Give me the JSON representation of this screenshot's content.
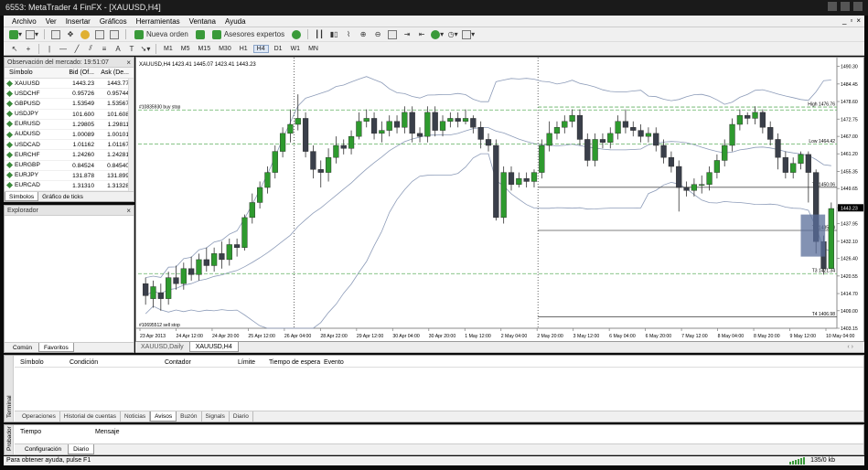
{
  "window": {
    "title": "6553: MetaTrader 4 FinFX - [XAUUSD,H4]"
  },
  "menu": [
    "Archivo",
    "Ver",
    "Insertar",
    "Gráficos",
    "Herramientas",
    "Ventana",
    "Ayuda"
  ],
  "toolbar": {
    "new_order": "Nueva orden",
    "expert_advisors": "Asesores expertos",
    "timeframes": [
      "M1",
      "M5",
      "M15",
      "M30",
      "H1",
      "H4",
      "D1",
      "W1",
      "MN"
    ],
    "active_timeframe": "H4"
  },
  "market_watch": {
    "title": "Observación del mercado: 19:51:07",
    "columns": [
      "Símbolo",
      "Bid (Of...",
      "Ask (De..."
    ],
    "rows": [
      {
        "symbol": "XAUUSD",
        "bid": "1443.23",
        "ask": "1443.77"
      },
      {
        "symbol": "USDCHF",
        "bid": "0.95726",
        "ask": "0.95744"
      },
      {
        "symbol": "GBPUSD",
        "bid": "1.53549",
        "ask": "1.53567"
      },
      {
        "symbol": "USDJPY",
        "bid": "101.600",
        "ask": "101.608"
      },
      {
        "symbol": "EURUSD",
        "bid": "1.29805",
        "ask": "1.29811"
      },
      {
        "symbol": "AUDUSD",
        "bid": "1.00089",
        "ask": "1.00101"
      },
      {
        "symbol": "USDCAD",
        "bid": "1.01162",
        "ask": "1.01167"
      },
      {
        "symbol": "EURCHF",
        "bid": "1.24260",
        "ask": "1.24281"
      },
      {
        "symbol": "EURGBP",
        "bid": "0.84524",
        "ask": "0.84540"
      },
      {
        "symbol": "EURJPY",
        "bid": "131.878",
        "ask": "131.899"
      },
      {
        "symbol": "EURCAD",
        "bid": "1.31310",
        "ask": "1.31328"
      }
    ],
    "tabs": [
      "Símbolos",
      "Gráfico de ticks"
    ],
    "active_tab": "Símbolos"
  },
  "explorer": {
    "title": "Explorador",
    "tabs": [
      "Común",
      "Favoritos"
    ],
    "active_tab": "Favoritos"
  },
  "chart": {
    "header": "XAUUSD,H4  1423.41 1445.07 1423.41 1443.23",
    "current_price": "1443.23",
    "tabs": [
      "XAUUSD,Daily",
      "XAUUSD,H4"
    ],
    "active_tab": "XAUUSD,H4"
  },
  "chart_data": {
    "type": "candlestick",
    "symbol": "XAUUSD",
    "timeframe": "H4",
    "ylim": [
      1403.15,
      1492.0
    ],
    "y_ticks": [
      1490.3,
      1484.45,
      1478.6,
      1472.75,
      1467.0,
      1461.2,
      1455.35,
      1449.65,
      1443.23,
      1437.95,
      1432.1,
      1426.4,
      1420.55,
      1414.7,
      1409.0,
      1403.15
    ],
    "x_labels": [
      "23 Apr 2013",
      "24 Apr 12:00",
      "24 Apr 20:00",
      "25 Apr 12:00",
      "26 Apr 04:00",
      "28 Apr 22:00",
      "29 Apr 12:00",
      "30 Apr 04:00",
      "30 Apr 20:00",
      "1 May 12:00",
      "2 May 04:00",
      "2 May 20:00",
      "3 May 12:00",
      "6 May 04:00",
      "6 May 20:00",
      "7 May 12:00",
      "8 May 04:00",
      "8 May 20:00",
      "9 May 12:00",
      "10 May 04:00"
    ],
    "candles": [
      [
        1418,
        1414,
        1420,
        1411
      ],
      [
        1413,
        1417,
        1419,
        1410
      ],
      [
        1415,
        1413,
        1418,
        1409
      ],
      [
        1413,
        1420,
        1422,
        1411
      ],
      [
        1420,
        1418,
        1424,
        1416
      ],
      [
        1418,
        1423,
        1425,
        1416
      ],
      [
        1423,
        1421,
        1427,
        1419
      ],
      [
        1421,
        1426,
        1428,
        1419
      ],
      [
        1426,
        1424,
        1430,
        1422
      ],
      [
        1424,
        1428,
        1430,
        1422
      ],
      [
        1428,
        1426,
        1432,
        1423
      ],
      [
        1426,
        1431,
        1433,
        1424
      ],
      [
        1431,
        1430,
        1433,
        1427
      ],
      [
        1430,
        1440,
        1441,
        1429
      ],
      [
        1440,
        1445,
        1448,
        1438
      ],
      [
        1445,
        1450,
        1452,
        1443
      ],
      [
        1450,
        1455,
        1457,
        1448
      ],
      [
        1455,
        1462,
        1464,
        1453
      ],
      [
        1462,
        1468,
        1470,
        1460
      ],
      [
        1468,
        1471,
        1476,
        1465
      ],
      [
        1471,
        1473,
        1481,
        1469
      ],
      [
        1473,
        1462,
        1475,
        1460
      ],
      [
        1462,
        1456,
        1464,
        1453
      ],
      [
        1456,
        1455,
        1459,
        1450
      ],
      [
        1455,
        1460,
        1463,
        1452
      ],
      [
        1460,
        1464,
        1467,
        1458
      ],
      [
        1464,
        1463,
        1466,
        1461
      ],
      [
        1463,
        1467,
        1469,
        1461
      ],
      [
        1467,
        1472,
        1475,
        1466
      ],
      [
        1472,
        1473,
        1476,
        1470
      ],
      [
        1473,
        1468,
        1475,
        1466
      ],
      [
        1468,
        1469,
        1472,
        1465
      ],
      [
        1469,
        1472,
        1474,
        1467
      ],
      [
        1472,
        1470,
        1474,
        1468
      ],
      [
        1470,
        1475,
        1477,
        1468
      ],
      [
        1475,
        1468,
        1477,
        1465
      ],
      [
        1468,
        1467,
        1470,
        1465
      ],
      [
        1467,
        1475,
        1477,
        1465
      ],
      [
        1475,
        1469,
        1477,
        1467
      ],
      [
        1469,
        1472,
        1474,
        1467
      ],
      [
        1472,
        1473,
        1475,
        1470
      ],
      [
        1473,
        1472,
        1475,
        1470
      ],
      [
        1472,
        1473,
        1476,
        1471
      ],
      [
        1473,
        1470,
        1474,
        1468
      ],
      [
        1470,
        1466,
        1472,
        1463
      ],
      [
        1466,
        1464,
        1468,
        1462
      ],
      [
        1464,
        1440,
        1466,
        1439
      ],
      [
        1440,
        1455,
        1457,
        1438
      ],
      [
        1455,
        1451,
        1457,
        1449
      ],
      [
        1451,
        1453,
        1455,
        1450
      ],
      [
        1453,
        1452,
        1455,
        1450
      ],
      [
        1452,
        1455,
        1456,
        1450
      ],
      [
        1455,
        1464,
        1466,
        1453
      ],
      [
        1464,
        1468,
        1472,
        1462
      ],
      [
        1468,
        1470,
        1472,
        1466
      ],
      [
        1470,
        1472,
        1474,
        1468
      ],
      [
        1472,
        1474,
        1476,
        1470
      ],
      [
        1474,
        1466,
        1476,
        1464
      ],
      [
        1466,
        1459,
        1468,
        1457
      ],
      [
        1459,
        1466,
        1468,
        1457
      ],
      [
        1466,
        1465,
        1468,
        1463
      ],
      [
        1465,
        1468,
        1470,
        1463
      ],
      [
        1468,
        1472,
        1474,
        1466
      ],
      [
        1472,
        1470,
        1476,
        1468
      ],
      [
        1470,
        1469,
        1472,
        1467
      ],
      [
        1469,
        1467,
        1471,
        1465
      ],
      [
        1467,
        1468,
        1470,
        1465
      ],
      [
        1468,
        1464,
        1470,
        1462
      ],
      [
        1464,
        1460,
        1466,
        1458
      ],
      [
        1460,
        1457,
        1462,
        1455
      ],
      [
        1457,
        1450,
        1459,
        1442
      ],
      [
        1450,
        1449,
        1452,
        1447
      ],
      [
        1449,
        1451,
        1453,
        1447
      ],
      [
        1451,
        1451,
        1454,
        1448
      ],
      [
        1451,
        1455,
        1457,
        1449
      ],
      [
        1455,
        1459,
        1461,
        1453
      ],
      [
        1459,
        1464,
        1466,
        1457
      ],
      [
        1464,
        1471,
        1473,
        1462
      ],
      [
        1471,
        1474,
        1476,
        1469
      ],
      [
        1474,
        1473,
        1475,
        1471
      ],
      [
        1473,
        1475,
        1477,
        1471
      ],
      [
        1475,
        1470,
        1476,
        1468
      ],
      [
        1470,
        1466,
        1472,
        1464
      ],
      [
        1466,
        1460,
        1468,
        1456
      ],
      [
        1460,
        1455,
        1462,
        1453
      ],
      [
        1455,
        1458,
        1460,
        1453
      ],
      [
        1458,
        1461,
        1462,
        1456
      ],
      [
        1461,
        1455,
        1462,
        1445
      ],
      [
        1455,
        1432,
        1456,
        1428
      ],
      [
        1432,
        1423,
        1434,
        1421
      ],
      [
        1423,
        1443,
        1445,
        1423
      ]
    ],
    "levels": [
      {
        "label": "#10835930 buy stop",
        "value": 1475.8,
        "style": "dashed",
        "color": "#60b060"
      },
      {
        "label": "High 1476.76",
        "value": 1476.76,
        "style": "dashed",
        "color": "#60b060"
      },
      {
        "label": "Low 1464.42",
        "value": 1464.42,
        "style": "dashed",
        "color": "#60b060"
      },
      {
        "label": "T1 1450.06",
        "value": 1450.06,
        "style": "solid",
        "color": "#555555"
      },
      {
        "label": "T2 1435.70",
        "value": 1435.7,
        "style": "solid",
        "color": "#555555"
      },
      {
        "label": "T3 1421.34",
        "value": 1421.34,
        "style": "dashed",
        "color": "#60b060"
      },
      {
        "label": "T4 1406.98",
        "value": 1406.98,
        "style": "solid",
        "color": "#555555"
      },
      {
        "label": "#10695512 sell stop",
        "value": 1403.2,
        "style": "none",
        "color": "#000000"
      }
    ],
    "colors": {
      "bull": "#2e9a2e",
      "bear": "#3a3f4a",
      "band": "#8c9bb8",
      "grid_dashed": "#60b060"
    }
  },
  "terminal": {
    "side_label": "Terminal",
    "columns": [
      "Símbolo",
      "Condición",
      "Contador",
      "Límite",
      "Tiempo de espera",
      "Evento"
    ],
    "tabs": [
      "Operaciones",
      "Historial de cuentas",
      "Noticias",
      "Avisos",
      "Buzón",
      "Signals",
      "Diario"
    ],
    "active_tab": "Avisos"
  },
  "tester": {
    "side_label": "Probador",
    "columns": [
      "Tiempo",
      "Mensaje"
    ],
    "tabs": [
      "Configuración",
      "Diario"
    ],
    "active_tab": "Diario"
  },
  "status": {
    "help": "Para obtener ayuda, pulse F1",
    "traffic": "135/0 kb"
  }
}
